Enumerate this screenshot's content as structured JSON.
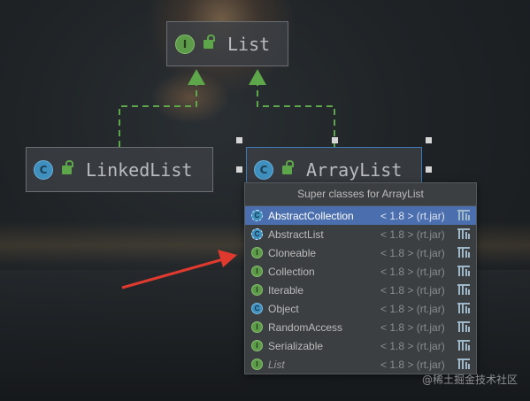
{
  "diagram": {
    "nodes": [
      {
        "id": "list",
        "name": "List",
        "kind": "interface",
        "icon": "interface-icon"
      },
      {
        "id": "linkedlist",
        "name": "LinkedList",
        "kind": "class",
        "icon": "class-icon"
      },
      {
        "id": "arraylist",
        "name": "ArrayList",
        "kind": "class",
        "icon": "class-icon",
        "selected": true
      }
    ],
    "edges": [
      {
        "from": "linkedlist",
        "to": "list",
        "style": "dashed",
        "color": "#5ea64a"
      },
      {
        "from": "arraylist",
        "to": "list",
        "style": "dashed",
        "color": "#5ea64a"
      }
    ]
  },
  "popup": {
    "title": "Super classes for ArrayList",
    "items": [
      {
        "name": "AbstractCollection",
        "icon": "abstract-class-icon",
        "version": "< 1.8 > (rt.jar)",
        "selected": true
      },
      {
        "name": "AbstractList",
        "icon": "abstract-class-icon",
        "version": "< 1.8 > (rt.jar)"
      },
      {
        "name": "Cloneable",
        "icon": "interface-icon",
        "version": "< 1.8 > (rt.jar)"
      },
      {
        "name": "Collection",
        "icon": "interface-icon",
        "version": "< 1.8 > (rt.jar)"
      },
      {
        "name": "Iterable",
        "icon": "interface-icon",
        "version": "< 1.8 > (rt.jar)"
      },
      {
        "name": "Object",
        "icon": "class-icon",
        "version": "< 1.8 > (rt.jar)"
      },
      {
        "name": "RandomAccess",
        "icon": "interface-icon",
        "version": "< 1.8 > (rt.jar)"
      },
      {
        "name": "Serializable",
        "icon": "interface-icon",
        "version": "< 1.8 > (rt.jar)"
      },
      {
        "name": "List",
        "icon": "interface-icon",
        "version": "< 1.8 > (rt.jar)",
        "italic": true
      }
    ]
  },
  "annotation": {
    "arrow_color": "#e03a2f",
    "icon": "red-arrow"
  },
  "watermark": "@稀土掘金技术社区",
  "colors": {
    "selection": "#4b6eaf",
    "edge": "#5ea64a",
    "popup_bg": "#3c3f41"
  }
}
